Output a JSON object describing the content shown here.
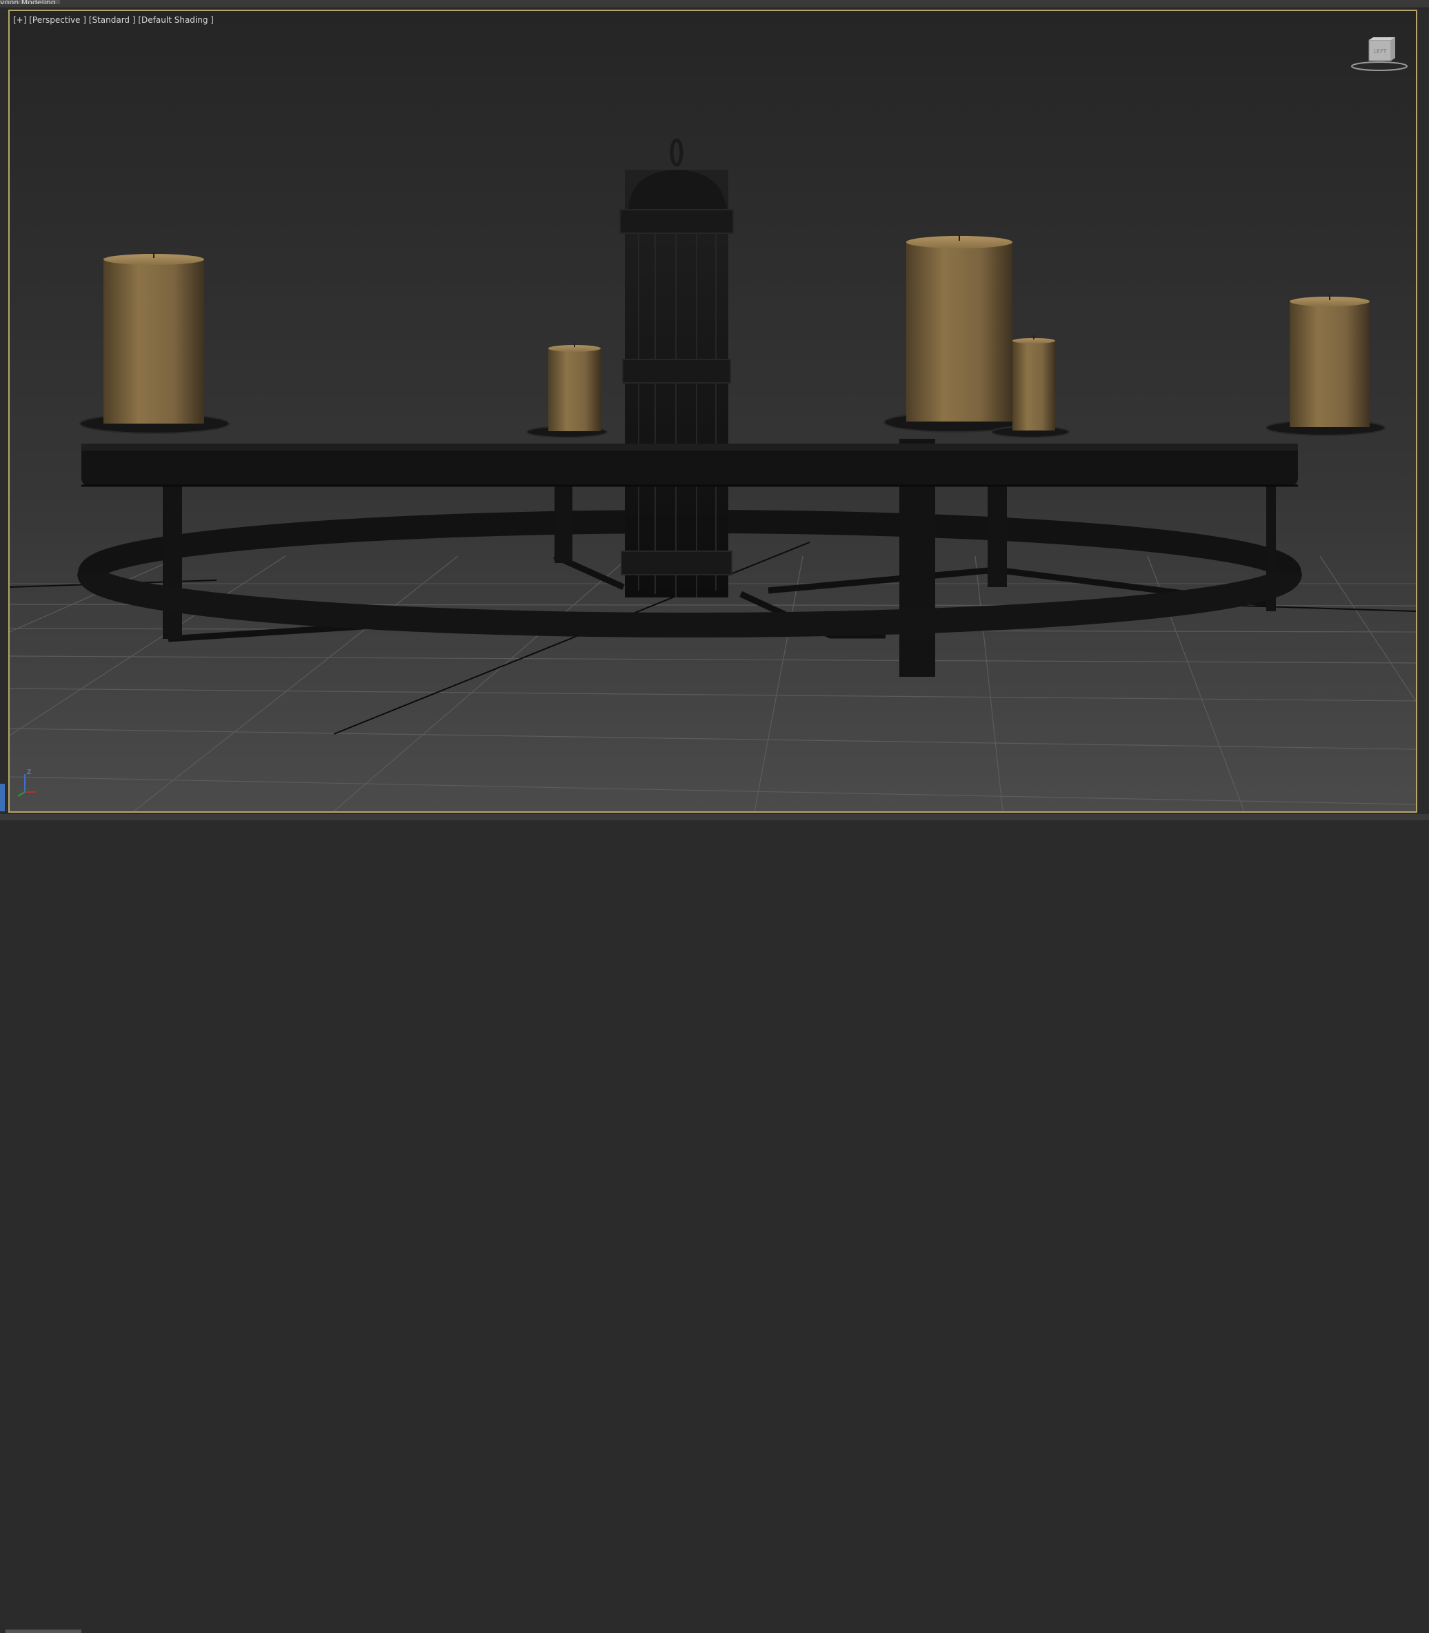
{
  "app": {
    "ribbon_tab": "ygon Modeling"
  },
  "viewport": {
    "label_parts": [
      "[+]",
      "[Perspective ]",
      "[Standard ]",
      "[Default Shading ]"
    ],
    "viewcube_face": "LEFT",
    "axis_tripod_label": "Z",
    "frame_color": "#b7a56a",
    "grid_color": "#5e5e5e",
    "background_top": "#262626",
    "background_bottom": "#4a4a4a"
  },
  "scene": {
    "object": "chandelier",
    "candle_color": "#8c7347",
    "iron_color": "#141414"
  }
}
